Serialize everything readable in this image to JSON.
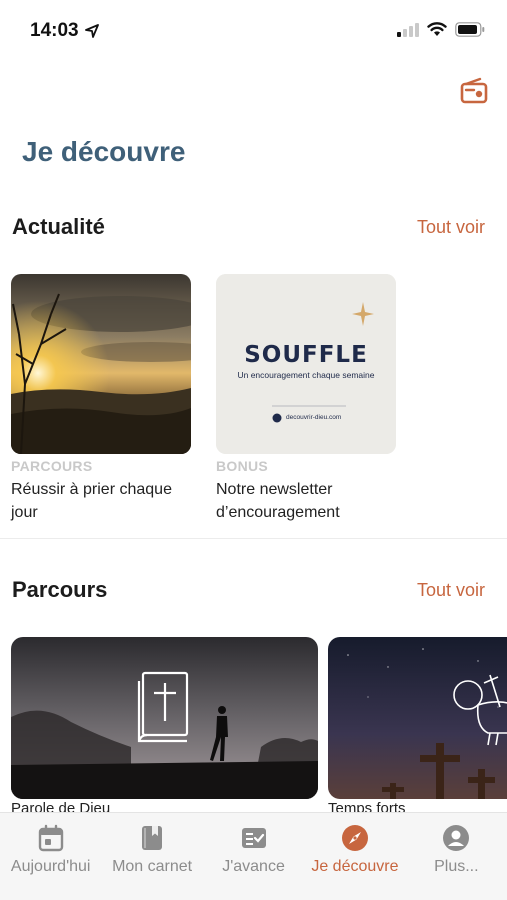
{
  "status_bar": {
    "time": "14:03"
  },
  "header": {
    "radio_icon": "radio-icon",
    "accent_color": "#c7663f"
  },
  "page": {
    "title": "Je découvre"
  },
  "actualite": {
    "title": "Actualité",
    "see_all": "Tout voir",
    "cards": [
      {
        "tag": "PARCOURS",
        "title": "Réussir à prier chaque jour",
        "image": "sunset-landscape"
      },
      {
        "tag": "BONUS",
        "title": "Notre newsletter d’encouragement",
        "image": "souffle-newsletter",
        "image_text": {
          "headline": "SOUFFLE",
          "subtitle": "Un encouragement chaque semaine",
          "footer": "decouvrir-dieu.com"
        }
      }
    ]
  },
  "parcours": {
    "title": "Parcours",
    "see_all": "Tout voir",
    "cards": [
      {
        "label": "Parole de Dieu",
        "image": "bible-walker"
      },
      {
        "label": "Temps forts",
        "image": "crosses-night"
      }
    ]
  },
  "tab_bar": {
    "tabs": [
      {
        "label": "Aujourd'hui",
        "icon": "calendar-icon",
        "active": false
      },
      {
        "label": "Mon carnet",
        "icon": "notebook-icon",
        "active": false
      },
      {
        "label": "J'avance",
        "icon": "checklist-icon",
        "active": false
      },
      {
        "label": "Je découvre",
        "icon": "compass-icon",
        "active": true
      },
      {
        "label": "Plus...",
        "icon": "profile-icon",
        "active": false
      }
    ]
  }
}
